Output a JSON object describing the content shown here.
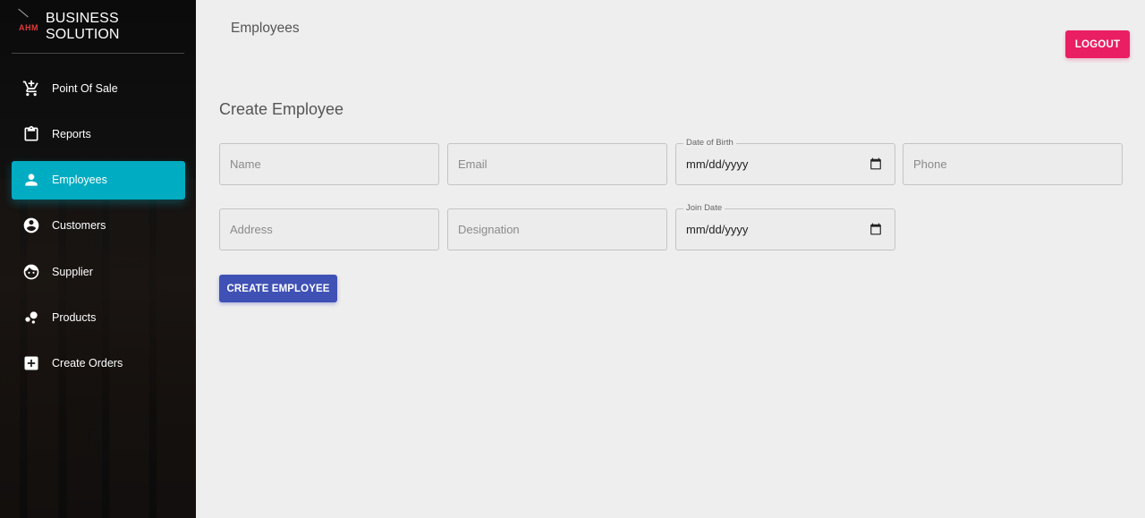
{
  "brand": {
    "logo_text": "AHM",
    "title": "BUSINESS SOLUTION"
  },
  "sidebar": {
    "items": [
      {
        "label": "Point Of Sale",
        "icon": "cart-icon"
      },
      {
        "label": "Reports",
        "icon": "clipboard-icon"
      },
      {
        "label": "Employees",
        "icon": "person-icon",
        "active": true
      },
      {
        "label": "Customers",
        "icon": "account-circle-icon"
      },
      {
        "label": "Supplier",
        "icon": "face-icon"
      },
      {
        "label": "Products",
        "icon": "bubble-chart-icon"
      },
      {
        "label": "Create Orders",
        "icon": "add-box-icon"
      }
    ]
  },
  "header": {
    "title": "Employees",
    "logout_label": "LOGOUT"
  },
  "form": {
    "title": "Create Employee",
    "name_placeholder": "Name",
    "email_placeholder": "Email",
    "dob_label": "Date of Birth",
    "dob_value": "mm/dd/yyyy",
    "phone_placeholder": "Phone",
    "address_placeholder": "Address",
    "designation_placeholder": "Designation",
    "join_label": "Join Date",
    "join_value": "mm/dd/yyyy",
    "submit_label": "CREATE EMPLOYEE"
  },
  "colors": {
    "accent_active": "#00acc1",
    "logout": "#e91e63",
    "primary_button": "#3f51b5",
    "logo": "#e23b3b"
  }
}
